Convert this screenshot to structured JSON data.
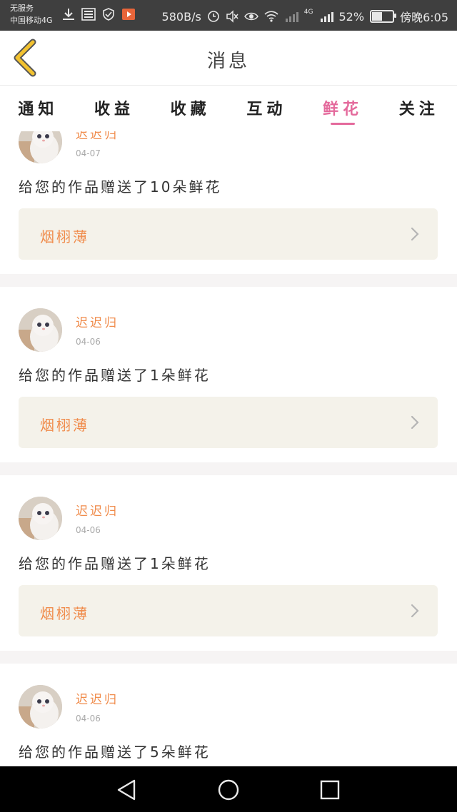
{
  "status_bar": {
    "carrier_line1": "无服务",
    "carrier_line2": "中国移动4G",
    "speed": "580B/s",
    "battery": "52%",
    "battery_level": 0.52,
    "time": "傍晚6:05",
    "network_label": "4G"
  },
  "header": {
    "title": "消息",
    "back_icon": "chevron-left-icon"
  },
  "tabs": [
    {
      "label": "通知",
      "active": false
    },
    {
      "label": "收益",
      "active": false
    },
    {
      "label": "收藏",
      "active": false
    },
    {
      "label": "互动",
      "active": false
    },
    {
      "label": "鲜花",
      "active": true
    },
    {
      "label": "关注",
      "active": false
    }
  ],
  "feed": {
    "items": [
      {
        "username": "迟迟归",
        "date": "04-07",
        "message": "给您的作品赠送了10朵鲜花",
        "work_title": "烟栩薄"
      },
      {
        "username": "迟迟归",
        "date": "04-06",
        "message": "给您的作品赠送了1朵鲜花",
        "work_title": "烟栩薄"
      },
      {
        "username": "迟迟归",
        "date": "04-06",
        "message": "给您的作品赠送了1朵鲜花",
        "work_title": "烟栩薄"
      },
      {
        "username": "迟迟归",
        "date": "04-06",
        "message": "给您的作品赠送了5朵鲜花",
        "work_title": ""
      }
    ]
  },
  "colors": {
    "accent_pink": "#e46a9c",
    "username_orange": "#f08c4c",
    "card_bg": "#f4f2ea",
    "back_arrow": "#f2c230"
  },
  "nav_bar": {
    "back_icon": "triangle-back-icon",
    "home_icon": "circle-home-icon",
    "recents_icon": "square-recents-icon"
  }
}
